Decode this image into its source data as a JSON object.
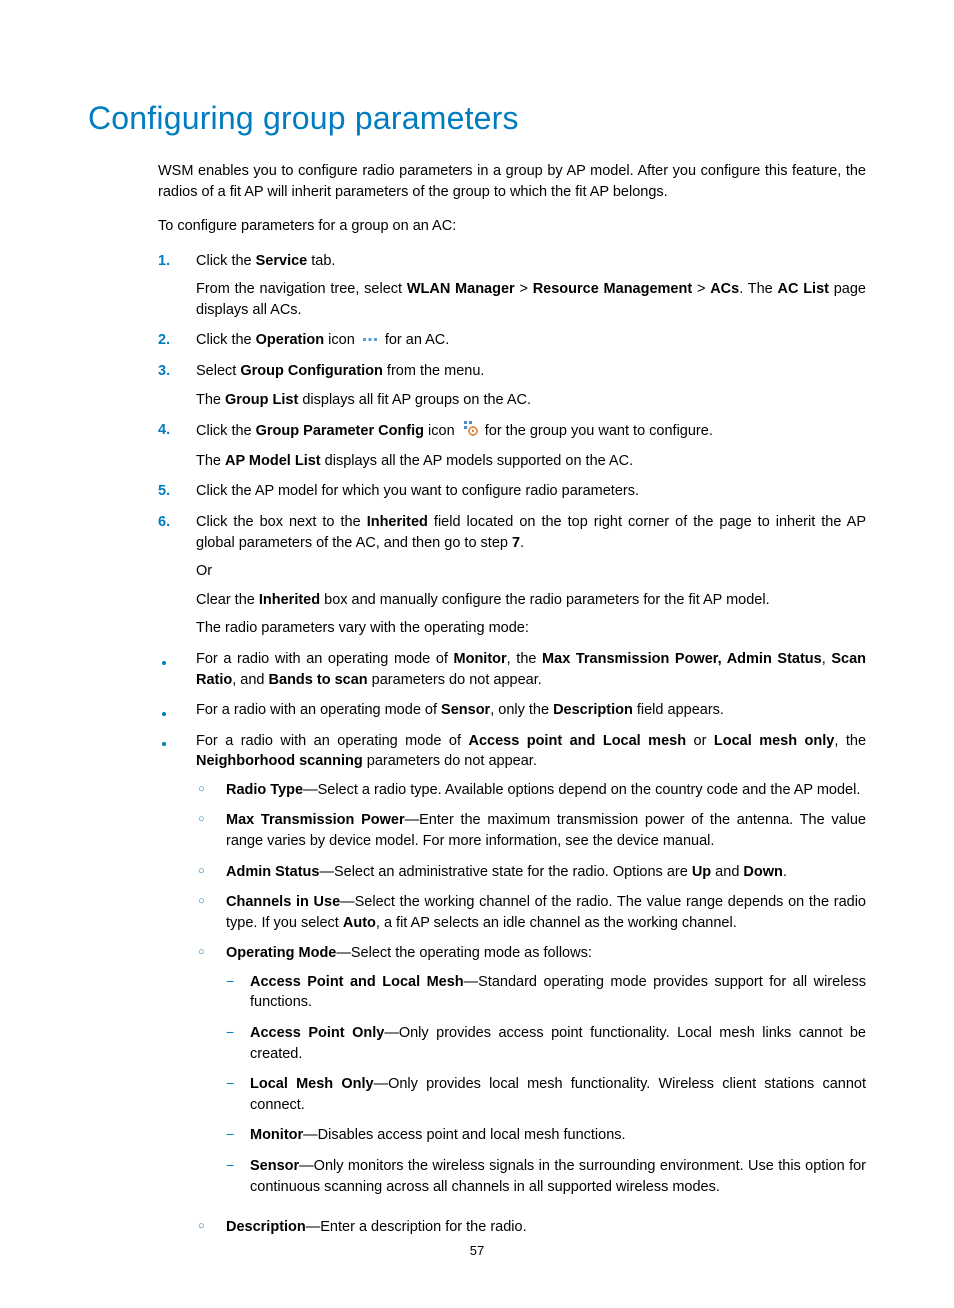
{
  "title": "Configuring group parameters",
  "intro": "WSM enables you to configure radio parameters in a group by AP model. After you configure this feature, the radios of a fit AP will inherit parameters of the group to which the fit AP belongs.",
  "lead": "To configure parameters for a group on an AC:",
  "steps": {
    "1": {
      "t1a": "Click the ",
      "t1b": "Service",
      "t1c": " tab.",
      "s1a": "From the navigation tree, select ",
      "s1b": "WLAN Manager",
      "s1c": " > ",
      "s1d": "Resource Management",
      "s1e": " > ",
      "s1f": "ACs",
      "s1g": ". The ",
      "s1h": "AC List",
      "s1i": " page displays all ACs."
    },
    "2": {
      "a": "Click the ",
      "b": "Operation",
      "c": " icon ",
      "d": " for an AC."
    },
    "3": {
      "a": "Select ",
      "b": "Group Configuration",
      "c": " from the menu.",
      "s_a": "The ",
      "s_b": "Group List",
      "s_c": " displays all fit AP groups on the AC."
    },
    "4": {
      "a": "Click the ",
      "b": "Group Parameter Config",
      "c": " icon ",
      "d": " for the group you want to configure.",
      "s_a": "The ",
      "s_b": "AP Model List",
      "s_c": " displays all the AP models supported on the AC."
    },
    "5": {
      "a": "Click the AP model for which you want to configure radio parameters."
    },
    "6": {
      "a": "Click the box next to the ",
      "b": "Inherited",
      "c": " field located on the top right corner of the page to inherit the AP global parameters of the AC, and then go to step ",
      "d": "7",
      "e": ".",
      "or": "Or",
      "f": "Clear the ",
      "g": "Inherited",
      "h": " box and manually configure the radio parameters for the fit AP model.",
      "i": "The radio parameters vary with the operating mode:"
    }
  },
  "bullets": {
    "0": {
      "a": "For a radio with an operating mode of ",
      "b": "Monitor",
      "c": ", the ",
      "d": "Max Transmission Power, Admin Status",
      "e": ", ",
      "f": "Scan Ratio",
      "g": ", and ",
      "h": "Bands to scan",
      "i": " parameters do not appear."
    },
    "1": {
      "a": "For a radio with an operating mode of ",
      "b": "Sensor",
      "c": ", only the ",
      "d": "Description",
      "e": " field appears."
    },
    "2": {
      "a": "For a radio with an operating mode of ",
      "b": "Access point and Local mesh",
      "c": " or ",
      "d": "Local mesh only",
      "e": ", the ",
      "f": "Neighborhood scanning",
      "g": " parameters do not appear."
    }
  },
  "params": {
    "0": {
      "a": "Radio Type",
      "b": "—Select a radio type. Available options depend on the country code and the AP model."
    },
    "1": {
      "a": "Max Transmission Power",
      "b": "—Enter the maximum transmission power of the antenna. The value range varies by device model. For more information, see the device manual."
    },
    "2": {
      "a": "Admin Status",
      "b": "—Select an administrative state for the radio. Options are ",
      "c": "Up",
      "d": " and ",
      "e": "Down",
      "f": "."
    },
    "3": {
      "a": "Channels in Use",
      "b": "—Select the working channel of the radio. The value range depends on the radio type. If you select ",
      "c": "Auto",
      "d": ", a fit AP selects an idle channel as the working channel."
    },
    "4": {
      "a": "Operating Mode",
      "b": "—Select the operating mode as follows:"
    },
    "5": {
      "a": "Description",
      "b": "—Enter a description for the radio."
    }
  },
  "modes": {
    "0": {
      "a": "Access Point and Local Mesh",
      "b": "—Standard operating mode provides support for all wireless functions."
    },
    "1": {
      "a": "Access Point Only",
      "b": "—Only provides access point functionality. Local mesh links cannot be created."
    },
    "2": {
      "a": "Local Mesh Only",
      "b": "—Only provides local mesh functionality. Wireless client stations cannot connect."
    },
    "3": {
      "a": "Monitor",
      "b": "—Disables access point and local mesh functions."
    },
    "4": {
      "a": "Sensor",
      "b": "—Only monitors the wireless signals in the surrounding environment. Use this option for continuous scanning across all channels in all supported wireless modes."
    }
  },
  "page_number": "57"
}
